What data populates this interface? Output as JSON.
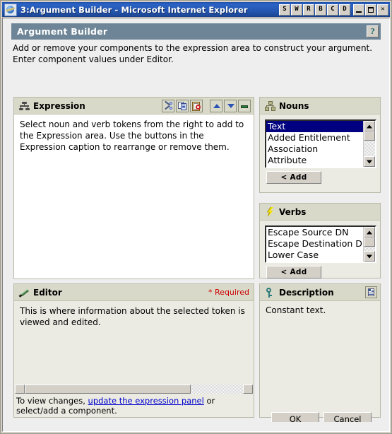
{
  "window": {
    "title": "3:Argument Builder - Microsoft Internet Explorer",
    "icon": "ie-globe-icon",
    "custom_buttons": [
      "S",
      "W",
      "R",
      "B",
      "C",
      "D"
    ],
    "minimize_label": "",
    "maximize_label": "",
    "close_label": "✕"
  },
  "page": {
    "header_title": "Argument Builder",
    "help_label": "?",
    "intro_line1": "Add or remove your components to the expression area to construct your argument.",
    "intro_line2": "Enter component values under Editor."
  },
  "expression": {
    "caption": "Expression",
    "icon": "hierarchy-icon",
    "body_text": "Select noun and verb tokens from the right to add to the Expression area.  Use the buttons in the Expression caption to rearrange or remove them.",
    "toolbar": {
      "cut": "cut-icon",
      "copy": "copy-icon",
      "paste": "paste-icon",
      "move_up": "arrow-up-icon",
      "move_down": "arrow-down-icon",
      "remove": "remove-icon"
    }
  },
  "nouns": {
    "caption": "Nouns",
    "icon": "org-chart-icon",
    "items": [
      {
        "label": "Text",
        "selected": true
      },
      {
        "label": "Added Entitlement",
        "selected": false
      },
      {
        "label": "Association",
        "selected": false
      },
      {
        "label": "Attribute",
        "selected": false
      }
    ],
    "add_label": "< Add"
  },
  "verbs": {
    "caption": "Verbs",
    "icon": "lightning-bolt-icon",
    "items": [
      {
        "label": "Escape Source DN",
        "selected": false
      },
      {
        "label": "Escape Destination DN",
        "selected": false
      },
      {
        "label": "Lower Case",
        "selected": false
      }
    ],
    "add_label": "< Add"
  },
  "editor": {
    "caption": "Editor",
    "icon": "pencil-icon",
    "required_label": "* Required",
    "body_text": "This is where information about the selected token is viewed and edited.",
    "status_prefix": "To view changes, ",
    "status_link": "update the expression panel",
    "status_suffix": " or select/add a component."
  },
  "description": {
    "caption": "Description",
    "icon": "key-icon",
    "doc_button_icon": "properties-icon",
    "body_text": "Constant text."
  },
  "dialog": {
    "ok_label": "OK",
    "cancel_label": "Cancel"
  },
  "colors": {
    "titlebar_blue": "#2558b4",
    "header_bar": "#6d8596",
    "panel_caption": "#d9d9c9",
    "panel_body": "#ebebe3",
    "selection_blue": "#000080",
    "required_red": "#cc0000",
    "link_blue": "#0000cc"
  }
}
